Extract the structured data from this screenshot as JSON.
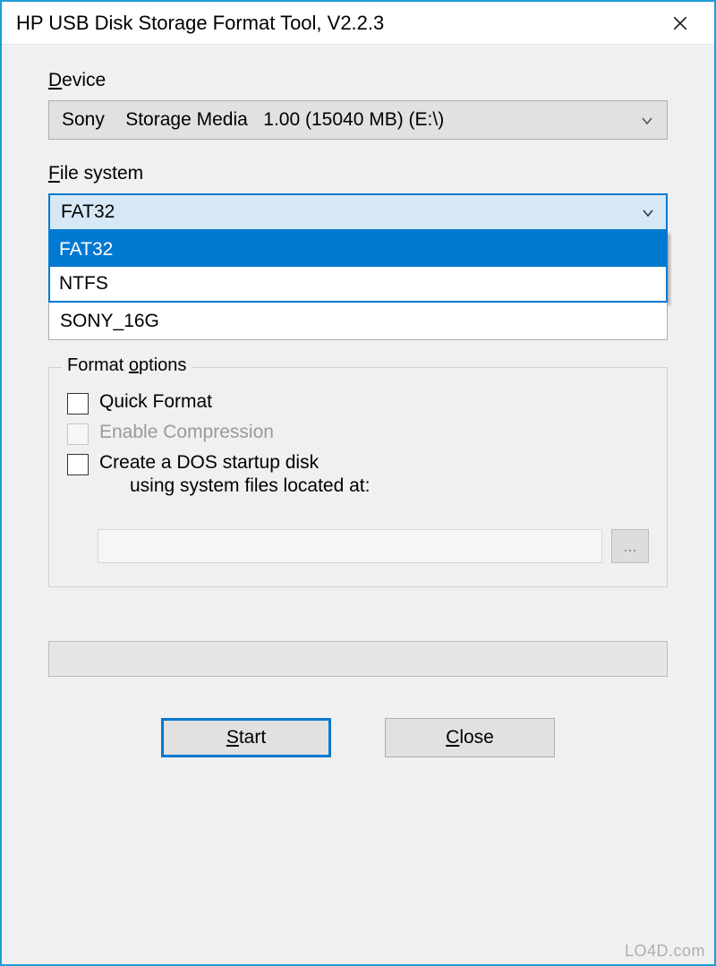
{
  "titlebar": {
    "title": "HP USB Disk Storage Format Tool, V2.2.3"
  },
  "device": {
    "label": "Device",
    "selected": "Sony    Storage Media   1.00 (15040 MB) (E:\\)"
  },
  "filesystem": {
    "label": "File system",
    "selected": "FAT32",
    "options": [
      "FAT32",
      "NTFS"
    ]
  },
  "volume": {
    "value": "SONY_16G"
  },
  "format_options": {
    "legend": "Format options",
    "quick_format": "Quick Format",
    "enable_compression": "Enable Compression",
    "dos_startup": "Create a DOS startup disk",
    "dos_startup_sub": "using system files located at:",
    "browse": "...",
    "path": ""
  },
  "buttons": {
    "start": "Start",
    "close": "Close"
  },
  "watermark": "LO4D.com"
}
